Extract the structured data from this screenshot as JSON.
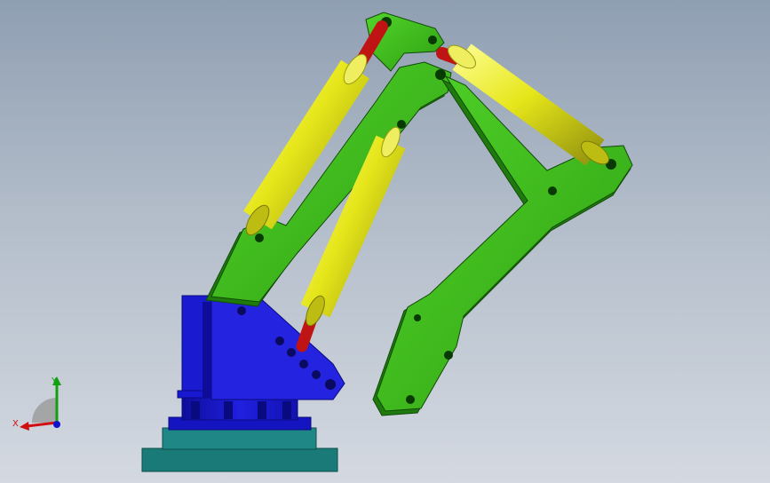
{
  "viewport": {
    "name": "3D model view",
    "background_top": "#8f9fb2",
    "background_bottom": "#d4d9e1"
  },
  "model": {
    "parts": [
      "base-plate",
      "turntable",
      "yaw-housing",
      "boom-arm",
      "stick-arm",
      "bucket-link",
      "boom-cylinder",
      "stick-cylinder",
      "tilt-cylinder"
    ],
    "colors": {
      "arm_green": "#3fbf1a",
      "arm_green_dark": "#1f7a0d",
      "cylinder_yellow": "#e6e61a",
      "cylinder_yellow_dark": "#9a9a10",
      "rod_red": "#c01414",
      "base_blue": "#1a1ad0",
      "base_blue_dark": "#0a0a80",
      "plate_teal": "#1a7a78",
      "plate_teal_dark": "#0d4d4b"
    }
  },
  "triad": {
    "x_label": "X",
    "y_label": "Y",
    "x_color": "#d01010",
    "y_color": "#10a010",
    "z_color": "#1010d0"
  }
}
